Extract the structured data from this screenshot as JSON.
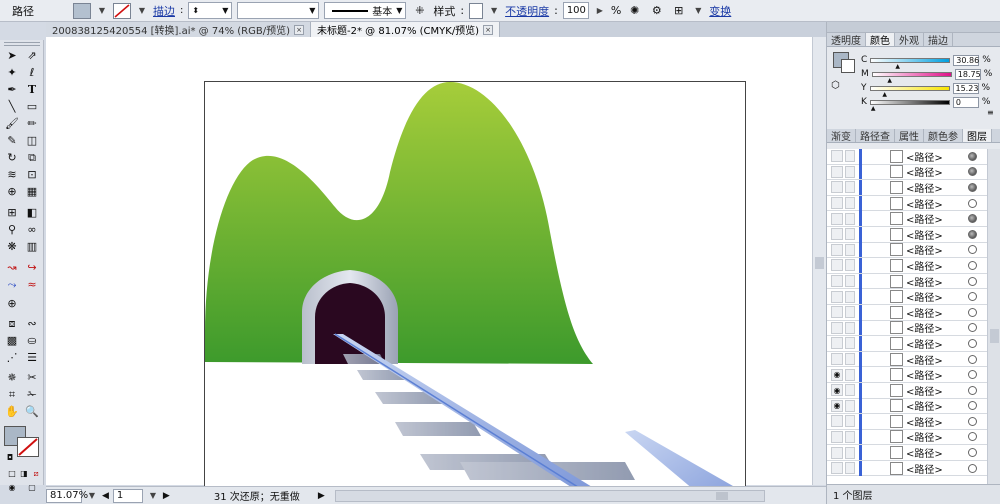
{
  "control": {
    "object_label": "路径",
    "stroke_label": "描边",
    "stroke_weight": "",
    "brush_label": "基本",
    "style_label": "样式",
    "opacity_label": "不透明度",
    "opacity_value": "100",
    "percent": "%",
    "transform_label": "变换"
  },
  "doc_tabs": [
    {
      "label": "200838125420554 [转换].ai* @ 74% (RGB/预览)",
      "active": false
    },
    {
      "label": "未标题-2* @ 81.07% (CMYK/预览)",
      "active": true
    }
  ],
  "tab_close": "×",
  "status": {
    "zoom": "81.07%",
    "page": "1",
    "message": "31 次还原；无重做",
    "play": "▶"
  },
  "color_panel": {
    "tabs": [
      "透明度",
      "颜色",
      "外观",
      "描边"
    ],
    "active_tab": 1,
    "channels": [
      {
        "label": "C",
        "value": "30.86",
        "percent": 30.86
      },
      {
        "label": "M",
        "value": "18.75",
        "percent": 18.75
      },
      {
        "label": "Y",
        "value": "15.23",
        "percent": 15.23
      },
      {
        "label": "K",
        "value": "0",
        "percent": 0
      }
    ],
    "unit": "%"
  },
  "layers_panel": {
    "tabs": [
      "渐变",
      "路径查",
      "属性",
      "颜色参",
      "图层"
    ],
    "active_tab": 4,
    "items": [
      {
        "name": "<路径>",
        "visible": false,
        "filled_target": true
      },
      {
        "name": "<路径>",
        "visible": false,
        "filled_target": true
      },
      {
        "name": "<路径>",
        "visible": false,
        "filled_target": true
      },
      {
        "name": "<路径>",
        "visible": false,
        "filled_target": false
      },
      {
        "name": "<路径>",
        "visible": false,
        "filled_target": true
      },
      {
        "name": "<路径>",
        "visible": false,
        "filled_target": true
      },
      {
        "name": "<路径>",
        "visible": false,
        "filled_target": false
      },
      {
        "name": "<路径>",
        "visible": false,
        "filled_target": false
      },
      {
        "name": "<路径>",
        "visible": false,
        "filled_target": false
      },
      {
        "name": "<路径>",
        "visible": false,
        "filled_target": false
      },
      {
        "name": "<路径>",
        "visible": false,
        "filled_target": false
      },
      {
        "name": "<路径>",
        "visible": false,
        "filled_target": false
      },
      {
        "name": "<路径>",
        "visible": false,
        "filled_target": false
      },
      {
        "name": "<路径>",
        "visible": false,
        "filled_target": false
      },
      {
        "name": "<路径>",
        "visible": true,
        "filled_target": false
      },
      {
        "name": "<路径>",
        "visible": true,
        "filled_target": false
      },
      {
        "name": "<路径>",
        "visible": true,
        "filled_target": false
      },
      {
        "name": "<路径>",
        "visible": false,
        "filled_target": false
      },
      {
        "name": "<路径>",
        "visible": false,
        "filled_target": false
      },
      {
        "name": "<路径>",
        "visible": false,
        "filled_target": false
      },
      {
        "name": "<路径>",
        "visible": false,
        "filled_target": false
      }
    ],
    "footer": "1 个图层"
  },
  "colors": {
    "mountain_top": "#a6cd3a",
    "mountain_bottom": "#3d9a2c",
    "tunnel_inner": "#2a0820",
    "rail_blue": "#5b7fd4",
    "sleeper_gray": "#8a92a8"
  }
}
